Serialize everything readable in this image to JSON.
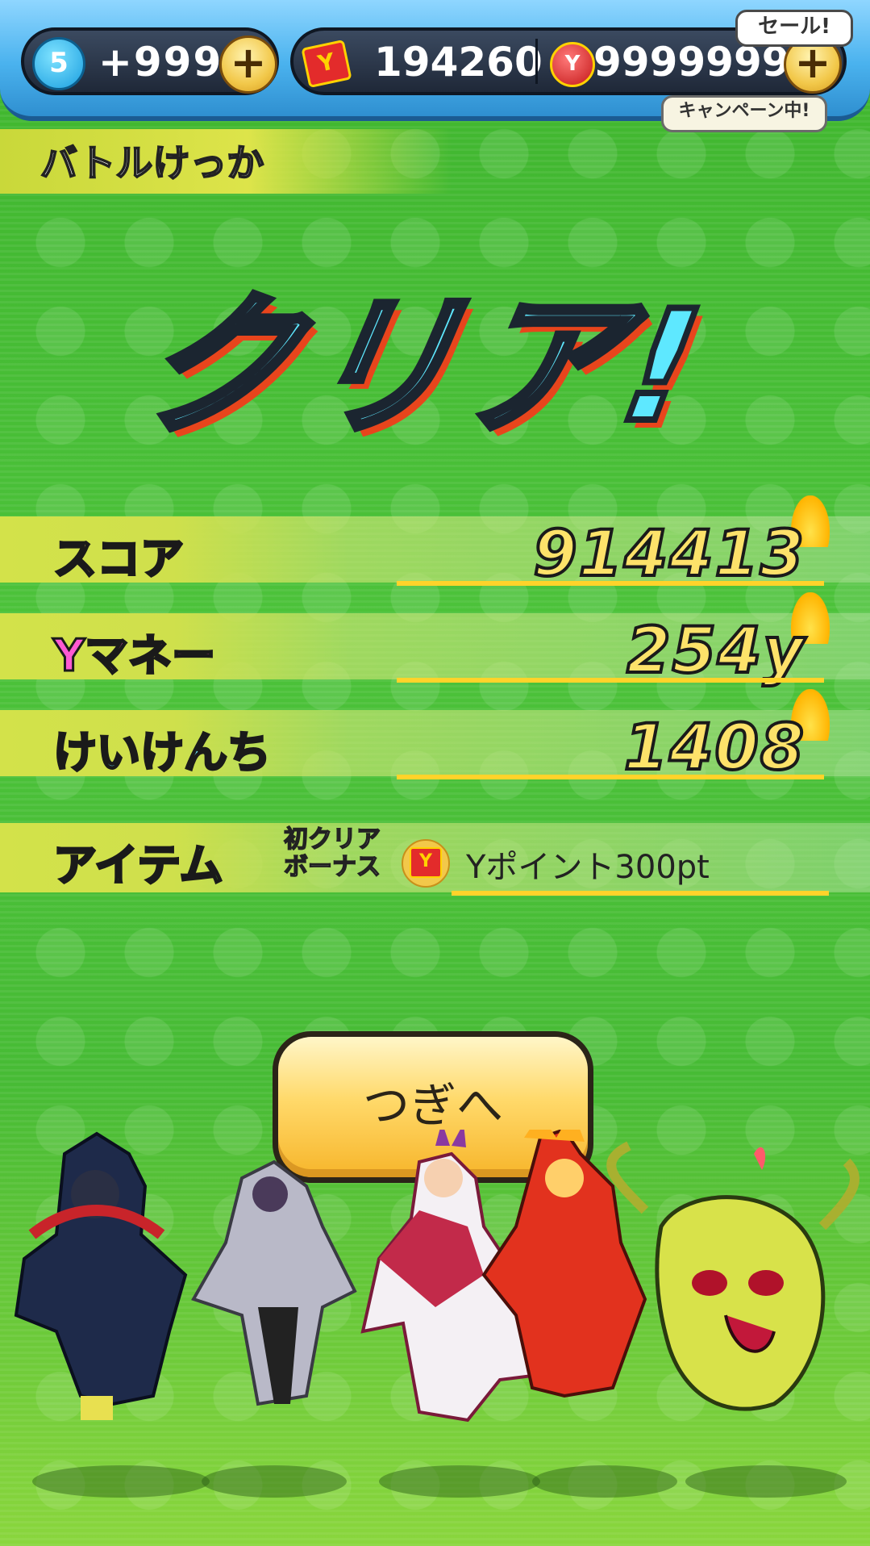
{
  "topbar": {
    "stamina_badge": "5",
    "stamina_value": "+999",
    "plus_glyph": "+",
    "ypoint_icon": "Y",
    "ypoint_value": "194260",
    "ymoney_icon": "Y",
    "ymoney_value": "9999999",
    "sale_tag": "セール!",
    "campaign_tag": "キャンペーン中!"
  },
  "header": {
    "title": "バトルけっか"
  },
  "clear_text": "クリア!",
  "results": {
    "score": {
      "label": "スコア",
      "value": "914413"
    },
    "ymoney": {
      "label": "Yマネー",
      "value": "254y"
    },
    "exp": {
      "label": "けいけんち",
      "value": "1408"
    },
    "item": {
      "label": "アイテム",
      "bonus_line1": "初クリア",
      "bonus_line2": "ボーナス",
      "bonus_icon": "Y",
      "value": "Yポイント300pt"
    }
  },
  "next_button": "つぎへ",
  "colors": {
    "bg_green": "#47bb35",
    "bar_blue": "#4ab2ee",
    "gold": "#fde26a",
    "cyan": "#5ee8ff",
    "ymoney_pink": "#ff5ad2",
    "exp_cyan": "#6ff0ff",
    "item_green": "#6dff3c"
  }
}
